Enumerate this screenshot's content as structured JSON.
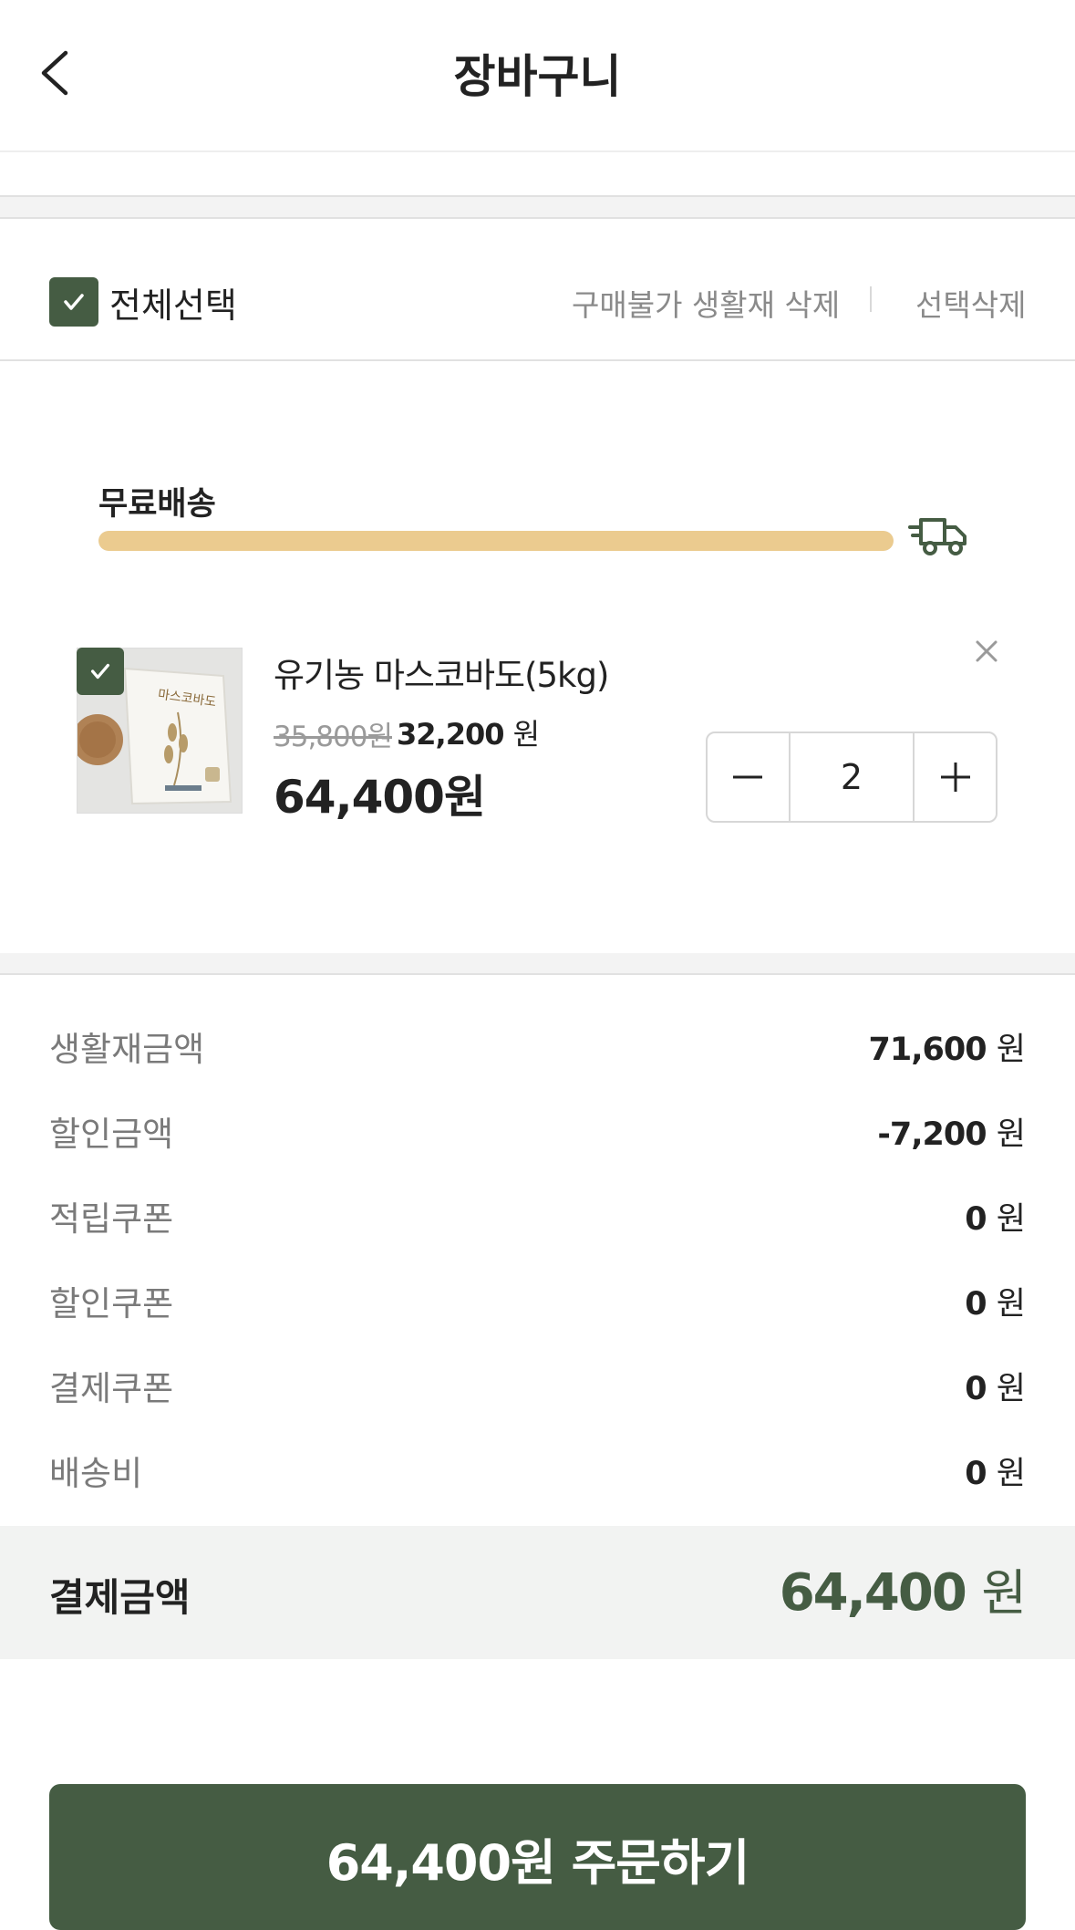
{
  "header": {
    "title": "장바구니"
  },
  "select_bar": {
    "select_all_label": "전체선택",
    "select_all_checked": true,
    "delete_unavailable_label": "구매불가 생활재 삭제",
    "delete_selected_label": "선택삭제"
  },
  "shipping": {
    "label": "무료배송",
    "progress": 1.0,
    "bar_color": "#ebcb8f",
    "icon": "delivery-truck-icon"
  },
  "product": {
    "name": "유기농 마스코바도(5kg)",
    "checked": true,
    "original_price": "35,800원",
    "sale_price_num": "32,200",
    "sale_price_unit": "원",
    "line_total": "64,400원",
    "quantity": "2",
    "image_label": "마스코바도"
  },
  "summary": {
    "rows": [
      {
        "label": "생활재금액",
        "value": "71,600",
        "unit": "원"
      },
      {
        "label": "할인금액",
        "value": "-7,200",
        "unit": "원"
      },
      {
        "label": "적립쿠폰",
        "value": "0",
        "unit": "원"
      },
      {
        "label": "할인쿠폰",
        "value": "0",
        "unit": "원"
      },
      {
        "label": "결제쿠폰",
        "value": "0",
        "unit": "원"
      },
      {
        "label": "배송비",
        "value": "0",
        "unit": "원"
      }
    ],
    "total_label": "결제금액",
    "total_value": "64,400",
    "total_unit": "원"
  },
  "order_button": {
    "label": "64,400원 주문하기"
  },
  "colors": {
    "accent": "#455c43",
    "shipping_bar": "#ebcb8f"
  }
}
